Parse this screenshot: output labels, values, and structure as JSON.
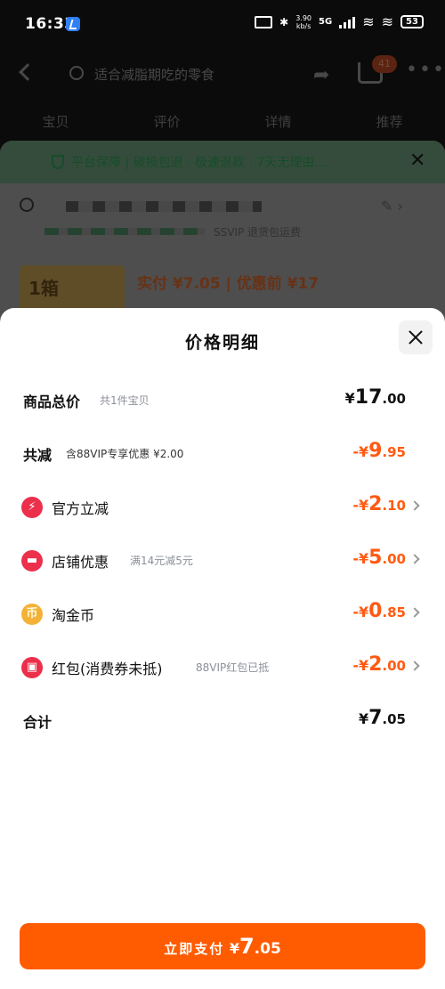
{
  "status_bar": {
    "time": "16:33",
    "net_speed": "3.90",
    "net_unit": "kb/s",
    "network": "5G",
    "battery": "53"
  },
  "background": {
    "search_placeholder": "适合减脂期吃的零食",
    "cart_badge": "41",
    "tabs": [
      "宝贝",
      "评价",
      "详情",
      "推荐"
    ],
    "guarantee_text": "平台保障 | 破损包退 · 极速退款 · 7天无理由...",
    "address_note": "SSVIP 退货包运费",
    "product_tag": "1箱",
    "price_line": "实付 ¥7.05 | 优惠前 ¥17"
  },
  "sheet": {
    "title": "价格明细",
    "rows": [
      {
        "label": "商品总价",
        "sub": "共1件宝贝",
        "sym": "¥",
        "int": "17",
        "dec": ".00",
        "color": "black"
      },
      {
        "label": "共减",
        "sub": "含88VIP专享优惠 ¥2.00",
        "sym": "-¥",
        "int": "9",
        "dec": ".95",
        "color": "orange"
      },
      {
        "label": "官方立减",
        "sub": "",
        "sym": "-¥",
        "int": "2",
        "dec": ".10",
        "color": "orange",
        "icon": "lightning-icon"
      },
      {
        "label": "店铺优惠",
        "sub": "满14元减5元",
        "sym": "-¥",
        "int": "5",
        "dec": ".00",
        "color": "orange",
        "icon": "shop-icon"
      },
      {
        "label": "淘金币",
        "sub": "",
        "sym": "-¥",
        "int": "0",
        "dec": ".85",
        "color": "orange",
        "icon": "coin-icon"
      },
      {
        "label": "红包(消费券未抵)",
        "sub": "88VIP红包已抵",
        "sym": "-¥",
        "int": "2",
        "dec": ".00",
        "color": "orange",
        "icon": "red-packet-icon"
      },
      {
        "label": "合计",
        "sub": "",
        "sym": "¥",
        "int": "7",
        "dec": ".05",
        "color": "black"
      }
    ],
    "pay_button": {
      "label": "立即支付",
      "sym": "¥",
      "int": "7",
      "dec": ".05"
    }
  },
  "colors": {
    "accent": "#ff5b00",
    "discount": "#ff5a12",
    "icon_red": "#ec2f4b",
    "icon_gold": "#f3b237"
  }
}
